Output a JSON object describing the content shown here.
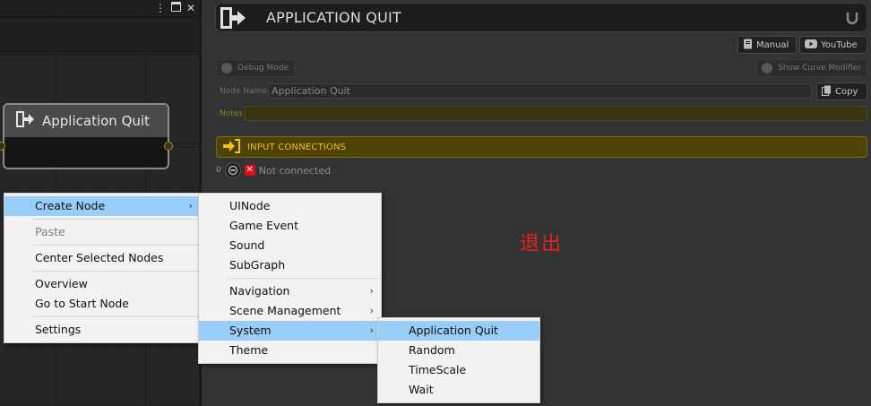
{
  "graph": {
    "header_icons": [
      "menu-dots-icon",
      "maximize-icon",
      "close-icon"
    ],
    "node": {
      "title": "Application Quit"
    }
  },
  "inspector": {
    "title": "APPLICATION QUIT",
    "manual_label": "Manual",
    "youtube_label": "YouTube",
    "debug_mode_label": "Debug Mode",
    "show_curve_label": "Show Curve Modifier",
    "node_name_label": "Node Name",
    "node_name_value": "Application Quit",
    "copy_label": "Copy",
    "notes_label": "Notes",
    "input_connections_label": "INPUT CONNECTIONS",
    "connection_index": "0",
    "not_connected_label": "Not connected",
    "annotation": "退出"
  },
  "context_menu": {
    "items": [
      {
        "label": "Create Node",
        "has_submenu": true,
        "highlighted": true
      },
      {
        "label": "Paste",
        "disabled": true
      },
      {
        "label": "Center Selected Nodes"
      },
      {
        "label": "Overview"
      },
      {
        "label": "Go to Start Node"
      },
      {
        "label": "Settings"
      }
    ]
  },
  "create_node_menu": {
    "items": [
      {
        "label": "UINode"
      },
      {
        "label": "Game Event"
      },
      {
        "label": "Sound"
      },
      {
        "label": "SubGraph"
      },
      {
        "label": "Navigation",
        "has_submenu": true
      },
      {
        "label": "Scene Management",
        "has_submenu": true
      },
      {
        "label": "System",
        "has_submenu": true,
        "highlighted": true
      },
      {
        "label": "Theme"
      }
    ]
  },
  "system_menu": {
    "items": [
      {
        "label": "Application Quit",
        "highlighted": true
      },
      {
        "label": "Random"
      },
      {
        "label": "TimeScale"
      },
      {
        "label": "Wait"
      }
    ]
  },
  "colors": {
    "menu_highlight": "#99ccf7",
    "connections_accent": "#f2c20e",
    "annotation": "#e8221e",
    "error_red": "#dd1111"
  }
}
